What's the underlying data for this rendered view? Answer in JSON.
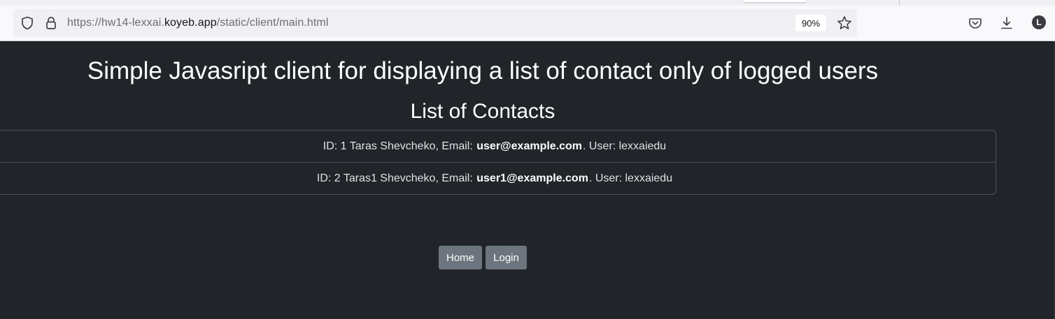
{
  "browser": {
    "url_prefix": "https://hw14-lexxai.",
    "url_host": "koyeb.app",
    "url_path": "/static/client/main.html",
    "zoom": "90%",
    "avatar_letter": "L"
  },
  "page": {
    "heading": "Simple Javasript client for displaying a list of contact only of logged users",
    "list_title": "List of Contacts",
    "contacts": [
      {
        "prefix": "ID: 1 Taras Shevcheko, Email: ",
        "email": "user@example.com",
        "suffix": ". User: lexxaiedu"
      },
      {
        "prefix": "ID: 2 Taras1 Shevcheko, Email: ",
        "email": "user1@example.com",
        "suffix": ". User: lexxaiedu"
      }
    ],
    "buttons": {
      "home": "Home",
      "login": "Login"
    }
  },
  "colors": {
    "page_background": "#212529",
    "button": "#6c757d",
    "toolbar": "#f9f9fb"
  },
  "icons": [
    "shield-icon",
    "lock-icon",
    "star-icon",
    "pocket-icon",
    "download-icon"
  ]
}
